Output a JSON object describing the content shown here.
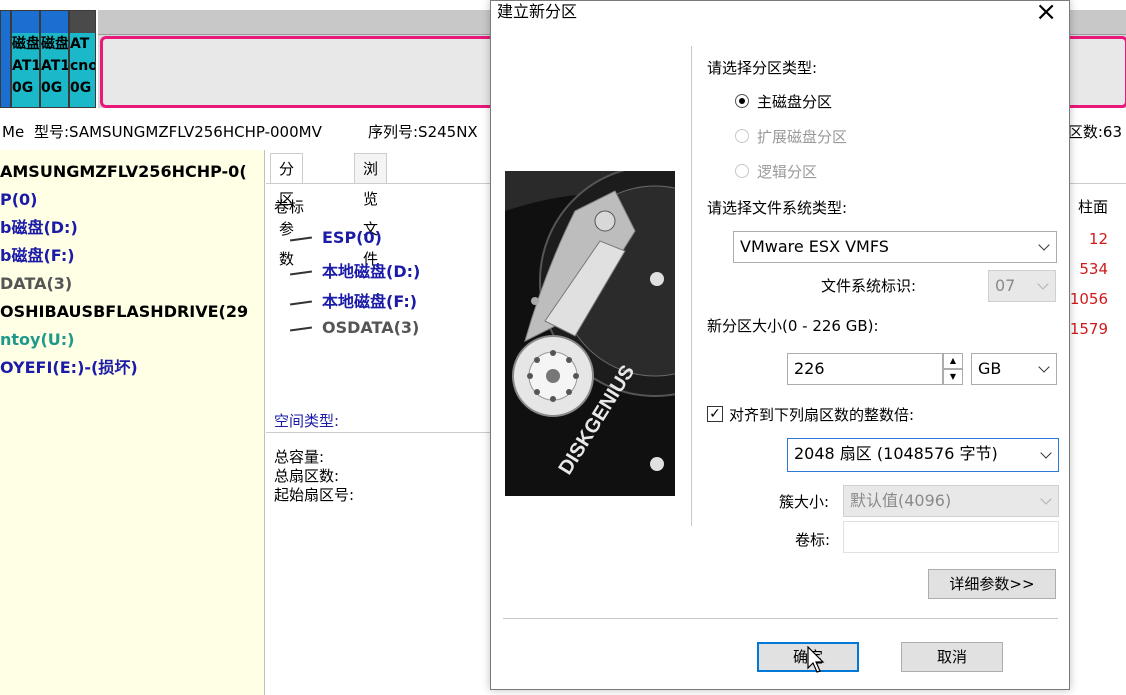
{
  "disk_map": {
    "segments": [
      {
        "lines": [
          "",
          "磁盘",
          "AT1",
          "0G"
        ],
        "color": "#1a6fd0"
      },
      {
        "lines": [
          "",
          "磁盘",
          "AT1",
          "0G"
        ],
        "color": "#1ab8c8"
      },
      {
        "lines": [
          "",
          "磁盘",
          "AT1",
          "0G"
        ],
        "color": "#1ab8c8"
      },
      {
        "lines": [
          "",
          "AT",
          "cno",
          "0G"
        ],
        "color": "#8a8a8a"
      }
    ]
  },
  "info_bar": {
    "prefix": "Me",
    "model": "型号:SAMSUNGMZFLV256HCHP-000MV",
    "serial": "序列号:S245NX",
    "sector_count": "区数:63"
  },
  "tree": {
    "items": [
      {
        "label": "AMSUNGMZFLV256HCHP-0(",
        "color": "#000000"
      },
      {
        "label": "P(0)",
        "color": "#1b1ba8"
      },
      {
        "label": "b磁盘(D:)",
        "color": "#1b1ba8"
      },
      {
        "label": "b磁盘(F:)",
        "color": "#1b1ba8"
      },
      {
        "label": "DATA(3)",
        "color": "#555555"
      },
      {
        "label": "OSHIBAUSBFLASHDRIVE(29",
        "color": "#000000"
      },
      {
        "label": "ntoy(U:)",
        "color": "#1f9a8a"
      },
      {
        "label": "OYEFI(E:)-(损坏)",
        "color": "#1b1ba8"
      }
    ]
  },
  "tabs": {
    "params": "分区参数",
    "browse": "浏览文件"
  },
  "partition_table": {
    "volume_header": "卷标",
    "cylinder_header": "柱面",
    "volumes": [
      "ESP(0)",
      "本地磁盘(D:)",
      "本地磁盘(F:)",
      "OSDATA(3)"
    ],
    "cylinders": [
      "12",
      "534",
      "1056",
      "1579"
    ]
  },
  "details": {
    "space_type": "空间类型:",
    "total_capacity": "总容量:",
    "total_sectors": "总扇区数:",
    "start_sector": "起始扇区号:"
  },
  "dialog": {
    "title": "建立新分区",
    "close_glyph": "×",
    "banner_text": "DISKGENIUS",
    "partition_type_label": "请选择分区类型:",
    "radio_primary": "主磁盘分区",
    "radio_extended": "扩展磁盘分区",
    "radio_logical": "逻辑分区",
    "fs_type_label": "请选择文件系统类型:",
    "fs_type_value": "VMware ESX VMFS",
    "fs_id_label": "文件系统标识:",
    "fs_id_value": "07",
    "size_label": "新分区大小(0 - 226 GB):",
    "size_value": "226",
    "size_unit": "GB",
    "align_label": "对齐到下列扇区数的整数倍:",
    "align_checked": true,
    "align_value": "2048 扇区 (1048576 字节)",
    "cluster_label": "簇大小:",
    "cluster_value": "默认值(4096)",
    "volume_label": "卷标:",
    "volume_value": "",
    "advanced_button": "详细参数>>",
    "ok_button": "确定",
    "cancel_button": "取消"
  },
  "colors": {
    "tree_bg": "#ffffe6",
    "partition_blue": "#1b1ba8",
    "cylinder_red": "#d01a1a",
    "focus_blue": "#0078d7",
    "active_partition_border": "#e8197a"
  }
}
